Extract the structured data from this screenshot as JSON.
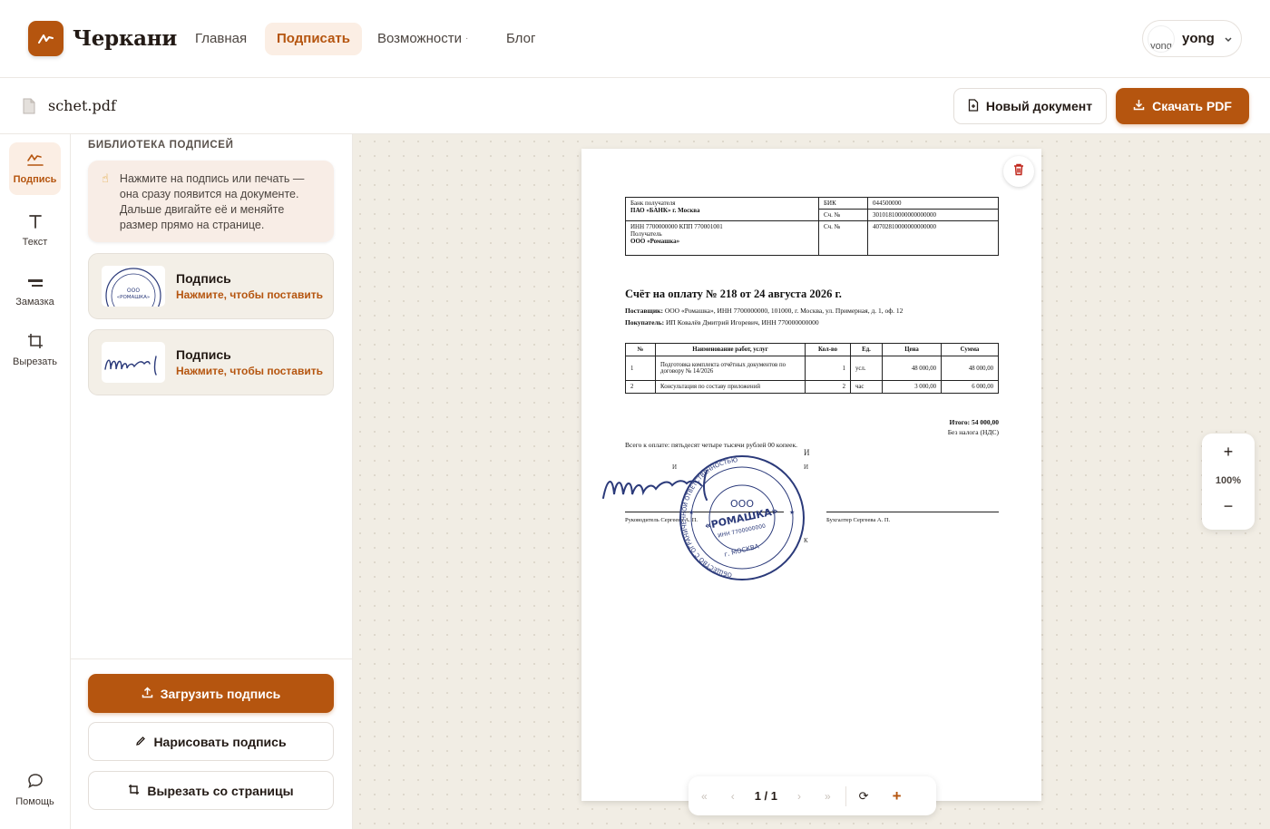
{
  "app": {
    "brand": "Черкани",
    "nav": [
      "Главная",
      "Подписать",
      "Возможности",
      "Блог"
    ],
    "nav_active": "Подписать",
    "nav_more_indicator": "·",
    "avatar_alt": "yong",
    "user_name": "yong",
    "accent_color": "#b5550f"
  },
  "toolbar": {
    "file_name": "schet.pdf",
    "new_doc_label": "Новый документ",
    "download_label": "Скачать PDF"
  },
  "rail": {
    "items": [
      "Подпись",
      "Текст",
      "Замазка",
      "Вырезать"
    ],
    "help": "Помощь"
  },
  "library": {
    "title": "БИБЛИОТЕКА ПОДПИСЕЙ",
    "hint": "Нажмите на подпись или печать — она сразу появится на документе. Дальше двигайте её и меняйте размер прямо на странице.",
    "hint_icon": "☝",
    "cards": [
      {
        "title": "Подпись",
        "action": "Нажмите, чтобы поставить",
        "thumb": "stamp"
      },
      {
        "title": "Подпись",
        "action": "Нажмите, чтобы поставить",
        "thumb": "signature"
      }
    ],
    "upload_label": "Загрузить подпись",
    "draw_label": "Нарисовать подпись",
    "cut_label": "Вырезать со страницы"
  },
  "document": {
    "bank": {
      "bank_label": "Банк получателя",
      "bank_name": "ПАО «БАНК» г. Москва",
      "bik_label": "БИК",
      "bik": "044500000",
      "corr_label": "Сч. №",
      "corr_account": "30101810000000000000",
      "inn_kpp": "ИНН 7700000000   КПП 770001001",
      "recipient_label": "Получатель",
      "recipient": "ООО «Ромашка»",
      "account_label": "Сч. №",
      "account": "40702810000000000000"
    },
    "title": "Счёт на оплату № 218 от 24 августа 2026 г.",
    "supplier_label": "Поставщик:",
    "supplier": "ООО «Ромашка», ИНН 7700000000, 101000, г. Москва, ул. Примерная, д. 1, оф. 12",
    "buyer_label": "Покупатель:",
    "buyer": "ИП Ковалёв Дмитрий Игоревич, ИНН 770000000000",
    "columns": [
      "№",
      "Наименование работ, услуг",
      "Кол-во",
      "Ед.",
      "Цена",
      "Сумма"
    ],
    "rows": [
      [
        "1",
        "Подготовка комплекта отчётных документов по договору № 14/2026",
        "1",
        "усл.",
        "48 000,00",
        "48 000,00"
      ],
      [
        "2",
        "Консультация по составу приложений",
        "2",
        "час",
        "3 000,00",
        "6 000,00"
      ]
    ],
    "total": "Итого: 54 000,00",
    "vat": "Без налога (НДС)",
    "sum_words": "Всего к оплате: пятьдесят четыре тысячи рублей 00 копеек.",
    "director_sign": "Руководитель   Сергеева А. П.",
    "accountant_sign": "Бухгалтер   Сергеева А. П.",
    "stamp": {
      "org": "ООО",
      "name": "«РОМАШКА»",
      "inn": "ИНН 7700000000",
      "city": "г. МОСКВА",
      "ring": "ОБЩЕСТВО С ОГРАНИЧЕННОЙ ОТВЕТСТВЕННОСТЬЮ"
    }
  },
  "pager": {
    "page": "1 / 1",
    "first": "«",
    "prev": "‹",
    "next": "›",
    "last": "»",
    "rotate": "⟳",
    "add": "+"
  },
  "zoom": {
    "plus": "+",
    "level": "100%",
    "minus": "−"
  }
}
